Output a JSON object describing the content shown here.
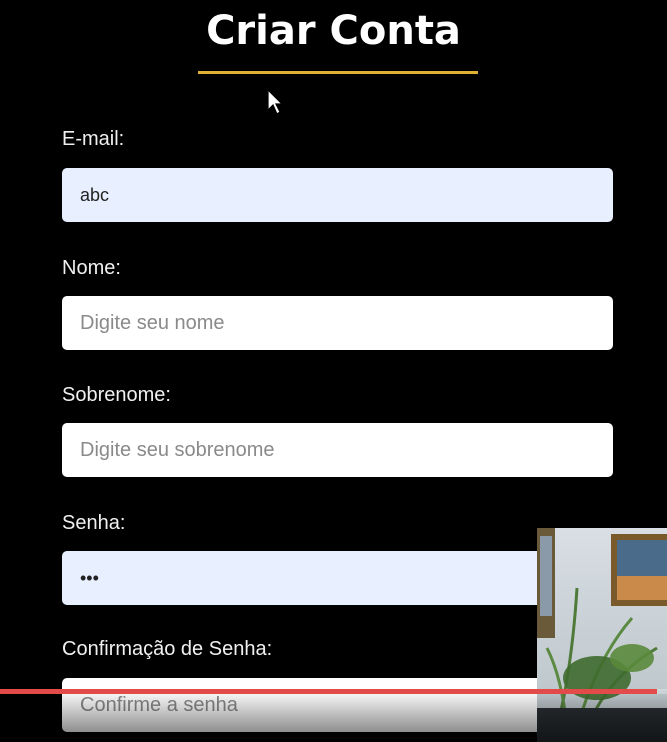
{
  "form": {
    "title": "Criar Conta",
    "email": {
      "label": "E-mail:",
      "value": "abc",
      "placeholder": ""
    },
    "nome": {
      "label": "Nome:",
      "value": "",
      "placeholder": "Digite seu nome"
    },
    "sobrenome": {
      "label": "Sobrenome:",
      "value": "",
      "placeholder": "Digite seu sobrenome"
    },
    "senha": {
      "label": "Senha:",
      "value": "•••",
      "placeholder": ""
    },
    "confirmacao": {
      "label": "Confirmação de Senha:",
      "value": "",
      "placeholder": "Confirme a senha"
    }
  },
  "video": {
    "progress_fraction": 0.985,
    "progress_color": "#e34b4b"
  },
  "colors": {
    "background": "#000000",
    "accent_underline": "#e0b030",
    "filled_input": "#e8efff"
  },
  "icons": {
    "cursor": "mouse-pointer-icon"
  }
}
